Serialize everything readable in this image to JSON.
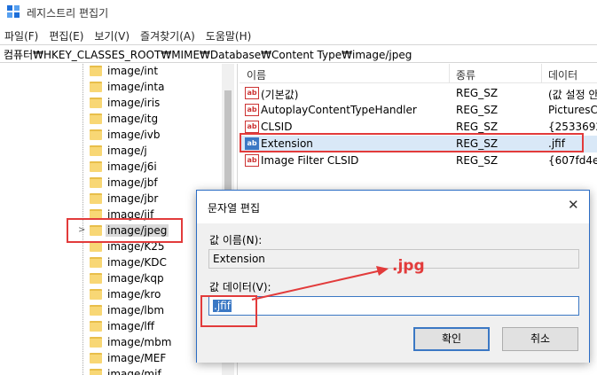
{
  "window": {
    "title": "레지스트리 편집기"
  },
  "menu": [
    "파일(F)",
    "편집(E)",
    "보기(V)",
    "즐겨찾기(A)",
    "도움말(H)"
  ],
  "address": "컴퓨터₩HKEY_CLASSES_ROOT₩MIME₩Database₩Content Type₩image/jpeg",
  "tree": {
    "items": [
      "image/int",
      "image/inta",
      "image/iris",
      "image/itg",
      "image/ivb",
      "image/j",
      "image/j6i",
      "image/jbf",
      "image/jbr",
      "image/jif",
      "image/jpeg",
      "image/K25",
      "image/KDC",
      "image/kqp",
      "image/kro",
      "image/lbm",
      "image/lff",
      "image/mbm",
      "image/MEF",
      "image/mif"
    ],
    "selected": "image/jpeg"
  },
  "values": {
    "columns": [
      "이름",
      "종류",
      "데이터"
    ],
    "rows": [
      {
        "name": "(기본값)",
        "type": "REG_SZ",
        "data": "(값 설정 안",
        "icon": "string-value-icon"
      },
      {
        "name": "AutoplayContentTypeHandler",
        "type": "REG_SZ",
        "data": "PicturesCo",
        "icon": "string-value-icon"
      },
      {
        "name": "CLSID",
        "type": "REG_SZ",
        "data": "{25336920",
        "icon": "string-value-icon"
      },
      {
        "name": "Extension",
        "type": "REG_SZ",
        "data": ".jfif",
        "icon": "string-value-icon"
      },
      {
        "name": "Image Filter CLSID",
        "type": "REG_SZ",
        "data": "{607fd4e8",
        "icon": "string-value-icon"
      }
    ],
    "icon_glyph": "ab"
  },
  "dialog": {
    "title": "문자열 편집",
    "close_glyph": "✕",
    "name_label": "값 이름(N):",
    "name_value": "Extension",
    "data_label": "값 데이터(V):",
    "data_value": ".jfif",
    "ok_label": "확인",
    "cancel_label": "취소"
  },
  "annotation": {
    "text": ".jpg",
    "color": "#e23b3b"
  },
  "colors": {
    "selection": "#3b78c4",
    "highlight": "#e23b3b",
    "folder": "#f8d775"
  }
}
